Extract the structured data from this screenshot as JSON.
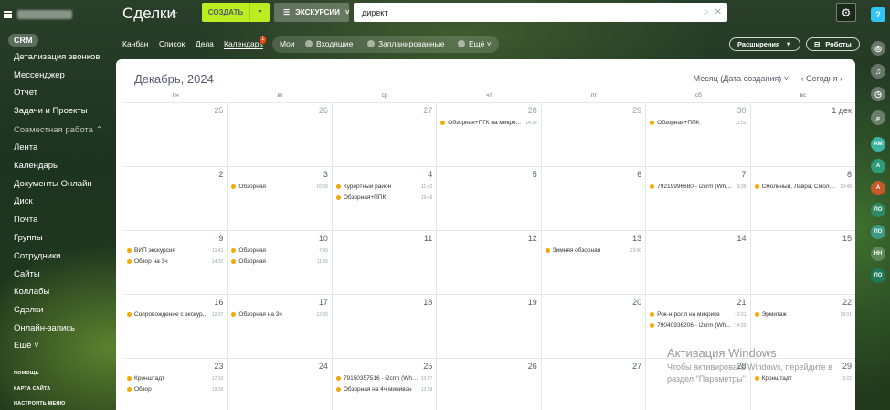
{
  "sidebar": {
    "crm": "CRM",
    "items": [
      "Детализация звонков",
      "Мессенджер",
      "Отчет",
      "Задачи и Проекты",
      "Совместная работа",
      "Лента",
      "Календарь",
      "Документы Онлайн",
      "Диск",
      "Почта",
      "Группы",
      "Сотрудники",
      "Сайты",
      "Коллабы",
      "Сделки",
      "Онлайн-запись",
      "Ещё"
    ],
    "footer": [
      "ПОМОЩЬ",
      "КАРТА САЙТА",
      "НАСТРОИТЬ МЕНЮ"
    ]
  },
  "header": {
    "title": "Сделки",
    "create_label": "СОЗДАТЬ",
    "filter_label": "ЭКСКУРСИИ",
    "search_value": "директ"
  },
  "toolbar": {
    "views": [
      "Канбан",
      "Список",
      "Дела",
      "Календарь"
    ],
    "badge": "1",
    "my": "Мои",
    "incoming": "Входящие",
    "planned": "Запланированные",
    "more": "Ещё",
    "extensions": "Расширения",
    "robots": "Роботы"
  },
  "calendar": {
    "month": "Декабрь, 2024",
    "view_selector": "Месяц (Дата создания)",
    "today": "Сегодня",
    "weekdays": [
      "пн",
      "вт",
      "ср",
      "чт",
      "пт",
      "сб",
      "вс"
    ],
    "weeks": [
      [
        {
          "d": "25",
          "o": true,
          "ev": []
        },
        {
          "d": "26",
          "o": true,
          "ev": []
        },
        {
          "d": "27",
          "o": true,
          "ev": []
        },
        {
          "d": "28",
          "o": true,
          "ev": [
            {
              "t": "Обзорная+ПГК на микрo...",
              "tm": "14:33"
            }
          ]
        },
        {
          "d": "29",
          "o": true,
          "ev": []
        },
        {
          "d": "30",
          "o": true,
          "ev": [
            {
              "t": "Обзорная+ППК",
              "tm": "11:52"
            }
          ]
        },
        {
          "d": "1 дек",
          "ev": []
        }
      ],
      [
        {
          "d": "2",
          "ev": []
        },
        {
          "d": "3",
          "ev": [
            {
              "t": "Обзорная",
              "tm": "10:59"
            }
          ]
        },
        {
          "d": "4",
          "ev": [
            {
              "t": "Курортный район",
              "tm": "11:42"
            },
            {
              "t": "Обзорная+ППК",
              "tm": "19:46"
            }
          ]
        },
        {
          "d": "5",
          "ev": []
        },
        {
          "d": "6",
          "ev": []
        },
        {
          "d": "7",
          "ev": [
            {
              "t": "79219996680 - i2crm (What...",
              "tm": "9:35"
            }
          ]
        },
        {
          "d": "8",
          "ev": [
            {
              "t": "Смольный, Лавра, Смоле...",
              "tm": "20:48"
            }
          ]
        }
      ],
      [
        {
          "d": "9",
          "ev": [
            {
              "t": "ВИП экскурсия",
              "tm": "11:41"
            },
            {
              "t": "Обзор на 3ч",
              "tm": "14:37"
            }
          ]
        },
        {
          "d": "10",
          "ev": [
            {
              "t": "Обзорная",
              "tm": "7:43"
            },
            {
              "t": "Обзорная",
              "tm": "11:59"
            }
          ]
        },
        {
          "d": "11",
          "ev": []
        },
        {
          "d": "12",
          "ev": []
        },
        {
          "d": "13",
          "ev": [
            {
              "t": "Зимняя обзорная",
              "tm": "13:00"
            }
          ]
        },
        {
          "d": "14",
          "ev": []
        },
        {
          "d": "15",
          "ev": []
        }
      ],
      [
        {
          "d": "16",
          "ev": [
            {
              "t": "Сопровождение с экскур...",
              "tm": "12:37"
            }
          ]
        },
        {
          "d": "17",
          "ev": [
            {
              "t": "Обзорная на 3ч",
              "tm": "12:50"
            }
          ]
        },
        {
          "d": "18",
          "ev": []
        },
        {
          "d": "19",
          "ev": []
        },
        {
          "d": "20",
          "ev": []
        },
        {
          "d": "21",
          "ev": [
            {
              "t": "Рок-н-ролл на микрике",
              "tm": "10:21"
            },
            {
              "t": "79040936206 - i2crm (Wh...",
              "tm": "14:20"
            }
          ]
        },
        {
          "d": "22",
          "ev": [
            {
              "t": "Эрмитаж",
              "tm": "18:01"
            }
          ]
        }
      ],
      [
        {
          "d": "23",
          "ev": [
            {
              "t": "Кронштадт",
              "tm": "17:13"
            },
            {
              "t": "Обзор",
              "tm": "19:16"
            }
          ]
        },
        {
          "d": "24",
          "ev": []
        },
        {
          "d": "25",
          "ev": [
            {
              "t": "79150357516 - i2crm (Wha...",
              "tm": "13:57"
            },
            {
              "t": "Обзорная на 4ч минивэн",
              "tm": "12:59"
            }
          ]
        },
        {
          "d": "26",
          "ev": []
        },
        {
          "d": "27",
          "ev": []
        },
        {
          "d": "28",
          "ev": []
        },
        {
          "d": "29",
          "ev": [
            {
              "t": "Кронштадт",
              "tm": "3:22"
            }
          ]
        }
      ]
    ]
  },
  "watermark": {
    "line1": "Активация Windows",
    "line2": "Чтобы активировать Windows, перейдите в",
    "line3": "раздел \"Параметры\"."
  },
  "rail": {
    "avatars": [
      {
        "label": "AM",
        "color": "#3bb3a0"
      },
      {
        "label": "А",
        "color": "#2f9a7a"
      },
      {
        "label": "А",
        "color": "#c45a2a"
      },
      {
        "label": "ЛО",
        "color": "#2f8a63"
      },
      {
        "label": "ЛО",
        "color": "#3b9a86"
      },
      {
        "label": "НН",
        "color": "#5a8a5a"
      },
      {
        "label": "ЛО",
        "color": "#1e7a5a"
      }
    ]
  },
  "colors": {
    "accent_green": "#bbed21",
    "event_dot": "#f7a700",
    "badge_red": "#f54819"
  }
}
